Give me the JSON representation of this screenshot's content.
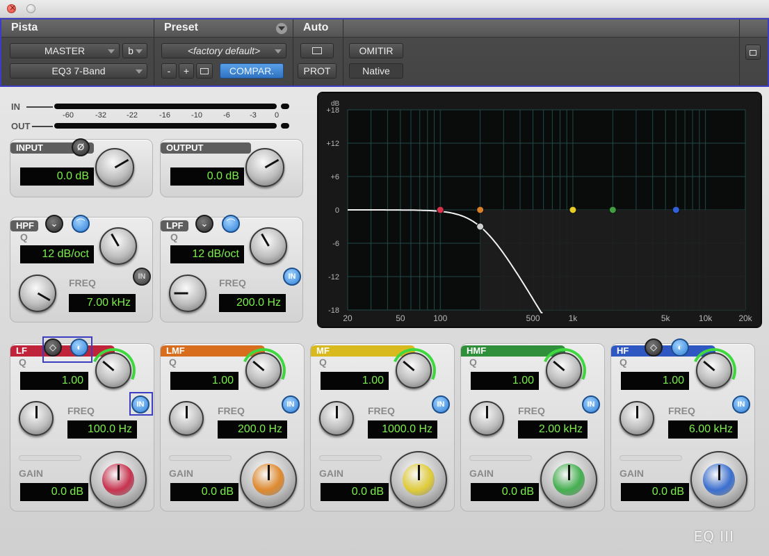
{
  "window": {
    "title": ""
  },
  "header": {
    "track_label": "Pista",
    "preset_label": "Preset",
    "auto_label": "Auto",
    "track_name": "MASTER",
    "track_variant": "b",
    "plugin_name": "EQ3 7-Band",
    "preset_name": "<factory default>",
    "minus": "-",
    "plus": "+",
    "compare": "COMPAR.",
    "bypass": "OMITIR",
    "prot": "PROT",
    "native": "Native"
  },
  "meters": {
    "in_label": "IN",
    "out_label": "OUT",
    "ticks": [
      "-60",
      "-32",
      "-22",
      "-16",
      "-10",
      "-6",
      "-3",
      "0"
    ]
  },
  "input": {
    "label": "INPUT",
    "value": "0.0 dB",
    "phase_icon": "Ø"
  },
  "output": {
    "label": "OUTPUT",
    "value": "0.0 dB"
  },
  "hpf": {
    "label": "HPF",
    "q_label": "Q",
    "q_value": "12 dB/oct",
    "freq_label": "FREQ",
    "freq_value": "7.00 kHz",
    "in_label": "IN",
    "enabled": false
  },
  "lpf": {
    "label": "LPF",
    "q_label": "Q",
    "q_value": "12 dB/oct",
    "freq_label": "FREQ",
    "freq_value": "200.0 Hz",
    "in_label": "IN",
    "enabled": true
  },
  "bands": [
    {
      "id": "lf",
      "label": "LF",
      "color": "#c0243a",
      "q": "1.00",
      "freq": "100.0 Hz",
      "gain": "0.0 dB",
      "cap": "#c8334f"
    },
    {
      "id": "lmf",
      "label": "LMF",
      "color": "#d86d1e",
      "q": "1.00",
      "freq": "200.0 Hz",
      "gain": "0.0 dB",
      "cap": "#e08a2e"
    },
    {
      "id": "mf",
      "label": "MF",
      "color": "#d8b91e",
      "q": "1.00",
      "freq": "1000.0 Hz",
      "gain": "0.0 dB",
      "cap": "#e0cc3a"
    },
    {
      "id": "hmf",
      "label": "HMF",
      "color": "#2f8f3a",
      "q": "1.00",
      "freq": "2.00 kHz",
      "gain": "0.0 dB",
      "cap": "#44b050"
    },
    {
      "id": "hf",
      "label": "HF",
      "color": "#2f57c2",
      "q": "1.00",
      "freq": "6.00 kHz",
      "gain": "0.0 dB",
      "cap": "#3a6fd0"
    }
  ],
  "band_labels": {
    "q": "Q",
    "freq": "FREQ",
    "gain": "GAIN",
    "in": "IN"
  },
  "graph": {
    "db_unit": "dB",
    "y_ticks": [
      "+18",
      "+12",
      "+6",
      "0",
      "-6",
      "-12",
      "-18"
    ],
    "x_ticks": [
      "20",
      "50",
      "100",
      "500",
      "1k",
      "5k",
      "10k",
      "20k"
    ],
    "nodes": [
      {
        "freq": 100,
        "gain": 0,
        "color": "#d8324a"
      },
      {
        "freq": 200,
        "gain": 0,
        "color": "#d8802a"
      },
      {
        "freq": 200,
        "gain": -3,
        "color": "#cfcfcf"
      },
      {
        "freq": 1000,
        "gain": 0,
        "color": "#e6cc28"
      },
      {
        "freq": 2000,
        "gain": 0,
        "color": "#3fa040"
      },
      {
        "freq": 6000,
        "gain": 0,
        "color": "#3060d8"
      }
    ]
  },
  "logo": "EQ III"
}
